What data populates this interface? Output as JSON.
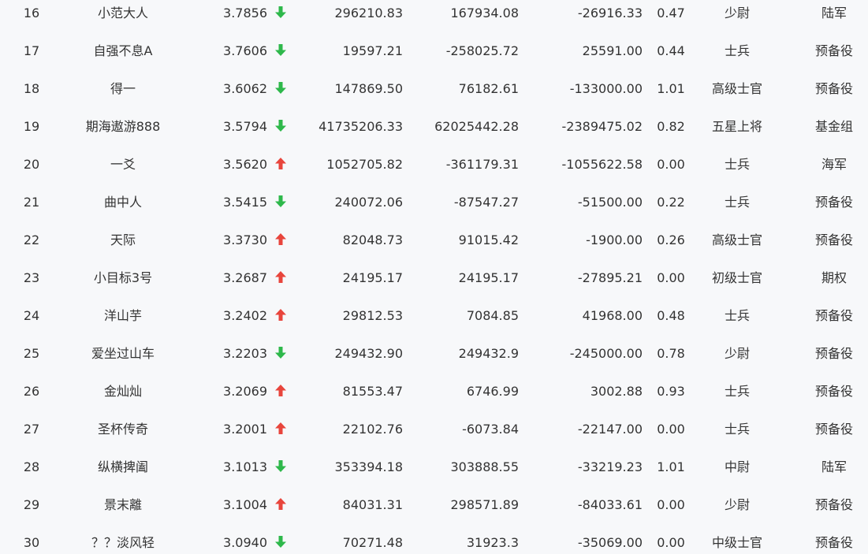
{
  "colors": {
    "up": "#e8453c",
    "down": "#2eb84b",
    "text": "#333333",
    "background": "#f7f8fa"
  },
  "rows": [
    {
      "rank": "16",
      "name": "小范大人",
      "score": "3.7856",
      "trend": "down",
      "a": "296210.83",
      "b": "167934.08",
      "c": "-26916.33",
      "ratio": "0.47",
      "level": "少尉",
      "group": "陆军"
    },
    {
      "rank": "17",
      "name": "自强不息A",
      "score": "3.7606",
      "trend": "down",
      "a": "19597.21",
      "b": "-258025.72",
      "c": "25591.00",
      "ratio": "0.44",
      "level": "士兵",
      "group": "预备役"
    },
    {
      "rank": "18",
      "name": "得一",
      "score": "3.6062",
      "trend": "down",
      "a": "147869.50",
      "b": "76182.61",
      "c": "-133000.00",
      "ratio": "1.01",
      "level": "高级士官",
      "group": "预备役"
    },
    {
      "rank": "19",
      "name": "期海遨游888",
      "score": "3.5794",
      "trend": "down",
      "a": "41735206.33",
      "b": "62025442.28",
      "c": "-2389475.02",
      "ratio": "0.82",
      "level": "五星上将",
      "group": "基金组"
    },
    {
      "rank": "20",
      "name": "一爻",
      "score": "3.5620",
      "trend": "up",
      "a": "1052705.82",
      "b": "-361179.31",
      "c": "-1055622.58",
      "ratio": "0.00",
      "level": "士兵",
      "group": "海军"
    },
    {
      "rank": "21",
      "name": "曲中人",
      "score": "3.5415",
      "trend": "down",
      "a": "240072.06",
      "b": "-87547.27",
      "c": "-51500.00",
      "ratio": "0.22",
      "level": "士兵",
      "group": "预备役"
    },
    {
      "rank": "22",
      "name": "天际",
      "score": "3.3730",
      "trend": "up",
      "a": "82048.73",
      "b": "91015.42",
      "c": "-1900.00",
      "ratio": "0.26",
      "level": "高级士官",
      "group": "预备役"
    },
    {
      "rank": "23",
      "name": "小目标3号",
      "score": "3.2687",
      "trend": "up",
      "a": "24195.17",
      "b": "24195.17",
      "c": "-27895.21",
      "ratio": "0.00",
      "level": "初级士官",
      "group": "期权"
    },
    {
      "rank": "24",
      "name": "洋山芋",
      "score": "3.2402",
      "trend": "up",
      "a": "29812.53",
      "b": "7084.85",
      "c": "41968.00",
      "ratio": "0.48",
      "level": "士兵",
      "group": "预备役"
    },
    {
      "rank": "25",
      "name": "爱坐过山车",
      "score": "3.2203",
      "trend": "down",
      "a": "249432.90",
      "b": "249432.9",
      "c": "-245000.00",
      "ratio": "0.78",
      "level": "少尉",
      "group": "预备役"
    },
    {
      "rank": "26",
      "name": "金灿灿",
      "score": "3.2069",
      "trend": "up",
      "a": "81553.47",
      "b": "6746.99",
      "c": "3002.88",
      "ratio": "0.93",
      "level": "士兵",
      "group": "预备役"
    },
    {
      "rank": "27",
      "name": "圣杯传奇",
      "score": "3.2001",
      "trend": "up",
      "a": "22102.76",
      "b": "-6073.84",
      "c": "-22147.00",
      "ratio": "0.00",
      "level": "士兵",
      "group": "预备役"
    },
    {
      "rank": "28",
      "name": "纵横捭阖",
      "score": "3.1013",
      "trend": "down",
      "a": "353394.18",
      "b": "303888.55",
      "c": "-33219.23",
      "ratio": "1.01",
      "level": "中尉",
      "group": "陆军"
    },
    {
      "rank": "29",
      "name": "景末離",
      "score": "3.1004",
      "trend": "up",
      "a": "84031.31",
      "b": "298571.89",
      "c": "-84033.61",
      "ratio": "0.00",
      "level": "少尉",
      "group": "预备役"
    },
    {
      "rank": "30",
      "name": "？？淡风轻",
      "score": "3.0940",
      "trend": "down",
      "a": "70271.48",
      "b": "31923.3",
      "c": "-35069.00",
      "ratio": "0.00",
      "level": "中级士官",
      "group": "预备役"
    }
  ]
}
